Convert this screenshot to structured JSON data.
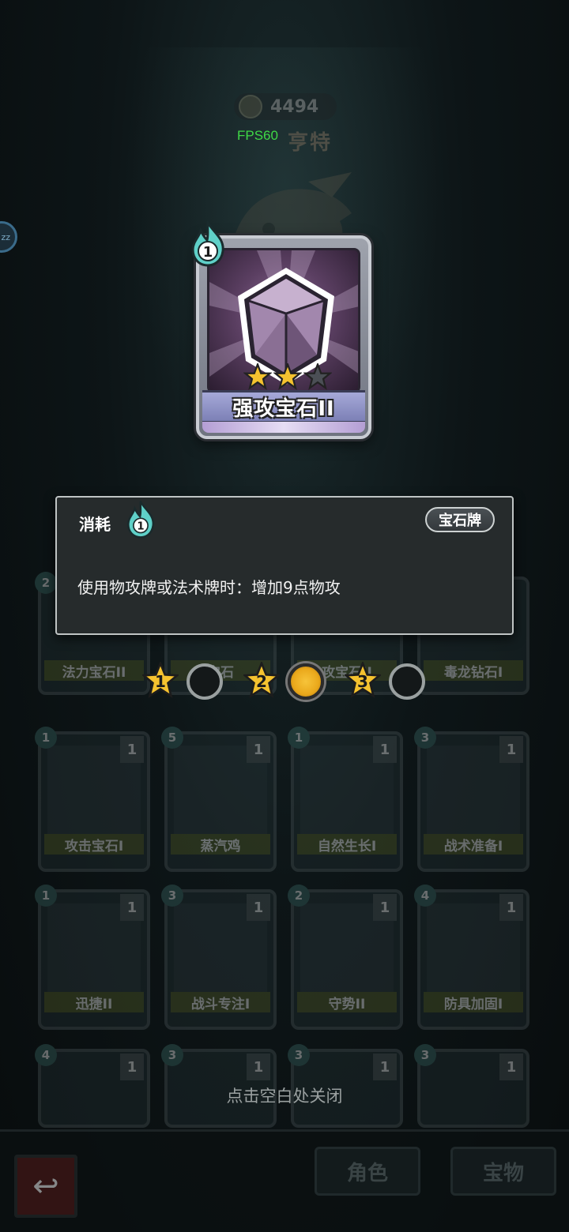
{
  "header": {
    "coins": "4494",
    "fps": "FPS60",
    "hero_name": "亨特",
    "side_bubble": "zz"
  },
  "focused_card": {
    "cost": "1",
    "name": "强攻宝石II",
    "stars_filled": 2,
    "stars_total": 3
  },
  "tooltip": {
    "cost_label": "消耗",
    "cost_value": "1",
    "type_badge": "宝石牌",
    "description": "使用物攻牌或法术牌时：增加9点物攻"
  },
  "levels": [
    {
      "label": "1",
      "selected": false
    },
    {
      "label": "2",
      "selected": true
    },
    {
      "label": "3",
      "selected": false
    }
  ],
  "collection": {
    "row1": [
      {
        "name": "法力宝石II",
        "cost": "2"
      },
      {
        "name": "宝石",
        "cost": ""
      },
      {
        "name": "攻宝石II",
        "cost": ""
      },
      {
        "name": "毒龙钻石I",
        "cost": ""
      }
    ],
    "row2": [
      {
        "name": "攻击宝石I",
        "cost": "1",
        "count": "1"
      },
      {
        "name": "蒸汽鸡",
        "cost": "5",
        "count": "1"
      },
      {
        "name": "自然生长I",
        "cost": "1",
        "count": "1"
      },
      {
        "name": "战术准备I",
        "cost": "3",
        "count": "1"
      }
    ],
    "row3": [
      {
        "name": "迅捷II",
        "cost": "1",
        "count": "1"
      },
      {
        "name": "战斗专注I",
        "cost": "3",
        "count": "1"
      },
      {
        "name": "守势II",
        "cost": "2",
        "count": "1"
      },
      {
        "name": "防具加固I",
        "cost": "4",
        "count": "1"
      }
    ],
    "row4": [
      {
        "name": "",
        "cost": "4",
        "count": "1"
      },
      {
        "name": "",
        "cost": "3",
        "count": "1"
      },
      {
        "name": "",
        "cost": "3",
        "count": "1"
      },
      {
        "name": "",
        "cost": "3",
        "count": "1"
      }
    ]
  },
  "close_hint": "点击空白处关闭",
  "bottom_nav": {
    "tab_character": "角色",
    "tab_treasure": "宝物"
  },
  "colors": {
    "accent_gold": "#f7c43a",
    "fps_green": "#3fd846",
    "mana_teal": "#5fd0c8"
  }
}
